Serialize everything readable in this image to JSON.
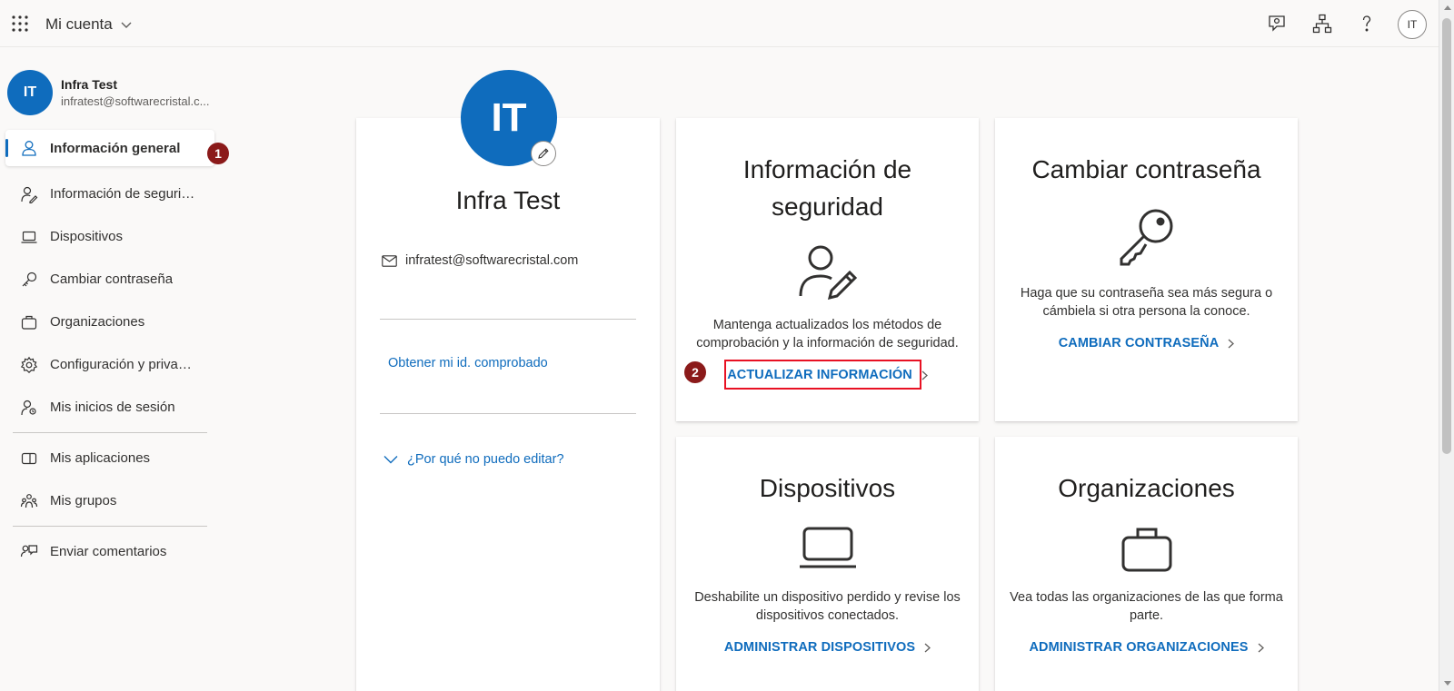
{
  "header": {
    "app_title": "Mi cuenta",
    "avatar_initials": "IT"
  },
  "user": {
    "initials": "IT",
    "name": "Infra Test",
    "email_short": "infratest@softwarecristal.c...",
    "email": "infratest@softwarecristal.com"
  },
  "sidebar": {
    "items": [
      {
        "label": "Información general",
        "icon": "person-icon",
        "active": true
      },
      {
        "label": "Información de segurid...",
        "icon": "person-key-icon"
      },
      {
        "label": "Dispositivos",
        "icon": "laptop-icon"
      },
      {
        "label": "Cambiar contraseña",
        "icon": "key-icon"
      },
      {
        "label": "Organizaciones",
        "icon": "briefcase-icon"
      },
      {
        "label": "Configuración y privaci...",
        "icon": "gear-icon"
      },
      {
        "label": "Mis inicios de sesión",
        "icon": "signin-icon"
      }
    ],
    "items2": [
      {
        "label": "Mis aplicaciones",
        "icon": "apps-icon"
      },
      {
        "label": "Mis grupos",
        "icon": "groups-icon"
      }
    ],
    "items3": [
      {
        "label": "Enviar comentarios",
        "icon": "feedback-icon"
      }
    ]
  },
  "badges": {
    "one": "1",
    "two": "2"
  },
  "profile_card": {
    "name": "Infra Test",
    "verify_link": "Obtener mi id. comprobado",
    "why_edit": "¿Por qué no puedo editar?"
  },
  "tiles": {
    "security": {
      "title": "Información de seguridad",
      "desc": "Mantenga actualizados los métodos de comprobación y la información de seguridad.",
      "link": "ACTUALIZAR INFORMACIÓN"
    },
    "password": {
      "title": "Cambiar contraseña",
      "desc": "Haga que su contraseña sea más segura o cámbiela si otra persona la conoce.",
      "link": "CAMBIAR CONTRASEÑA"
    },
    "devices": {
      "title": "Dispositivos",
      "desc": "Deshabilite un dispositivo perdido y revise los dispositivos conectados.",
      "link": "ADMINISTRAR DISPOSITIVOS"
    },
    "orgs": {
      "title": "Organizaciones",
      "desc": "Vea todas las organizaciones de las que forma parte.",
      "link": "ADMINISTRAR ORGANIZACIONES"
    }
  },
  "colors": {
    "accent": "#0f6cbd",
    "badge": "#8b1a1a",
    "highlight": "#e81123"
  }
}
